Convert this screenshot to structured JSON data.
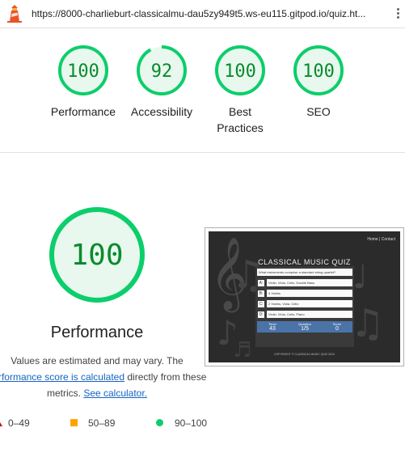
{
  "browser": {
    "url": "https://8000-charlieburt-classicalmu-dau5zy949t5.ws-eu115.gitpod.io/quiz.ht...",
    "logo_icon": "lighthouse-icon",
    "menu_icon": "kebab-menu-icon"
  },
  "colors": {
    "pass": "#0cce6b",
    "pass_text": "#0a8a2e",
    "pass_fill": "#e8f8ee",
    "average": "#ffa400",
    "fail": "#cc0000",
    "link": "#1565c0"
  },
  "categories": [
    {
      "score": "100",
      "value": 100,
      "label": "Performance"
    },
    {
      "score": "92",
      "value": 92,
      "label": "Accessibility"
    },
    {
      "score": "100",
      "value": 100,
      "label": "Best Practices"
    },
    {
      "score": "100",
      "value": 100,
      "label": "SEO"
    }
  ],
  "performance": {
    "score": "100",
    "value": 100,
    "title": "Performance",
    "note_prefix": "Values are estimated and may vary. The",
    "note_link": "performance score is calculated",
    "note_middle": "directly from these metrics.",
    "note_calc_link": "See calculator."
  },
  "legend": [
    {
      "range": "0–49",
      "shape": "triangle"
    },
    {
      "range": "50–89",
      "shape": "square"
    },
    {
      "range": "90–100",
      "shape": "circle"
    }
  ],
  "screenshot": {
    "nav": "Home | Contact",
    "title": "CLASSICAL MUSIC QUIZ",
    "question": "What instruments comprise a standard string quartet?",
    "options": [
      {
        "letter": "A:",
        "text": "Violin, Viola, Cello, Double Bass"
      },
      {
        "letter": "B:",
        "text": "4 Violins"
      },
      {
        "letter": "C:",
        "text": "2 Violins, Viola, Cello"
      },
      {
        "letter": "D:",
        "text": "Violin, Viola, Cello, Piano"
      }
    ],
    "stats": [
      {
        "label": "Timer",
        "value": "43"
      },
      {
        "label": "Question",
        "value": "1/5"
      },
      {
        "label": "Score",
        "value": "0"
      }
    ],
    "copyright": "COPYRIGHT © CLASSICAL MUSIC QUIZ 2024"
  }
}
